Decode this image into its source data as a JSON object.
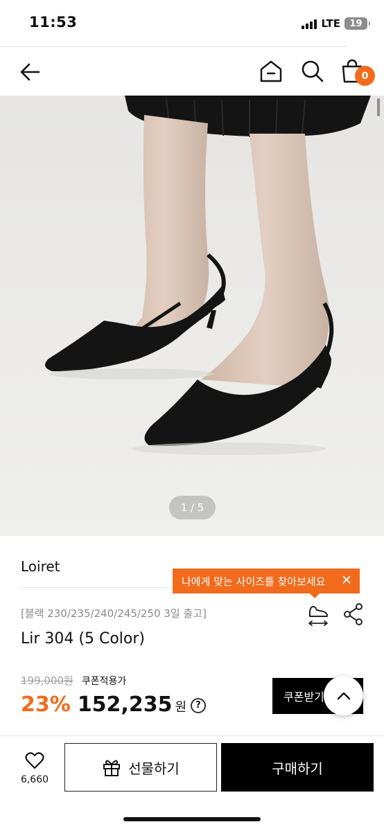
{
  "status_bar": {
    "time": "11:53",
    "network": "LTE",
    "battery": "19"
  },
  "nav": {
    "back_icon": "arrow-left-icon",
    "home_icon": "home-icon",
    "search_icon": "search-icon",
    "cart_icon": "shopping-bag-icon",
    "cart_count": "0"
  },
  "hero": {
    "pager": "1 / 5",
    "image_alt": "black pointed-toe slingback kitten heels"
  },
  "product": {
    "brand": "Loiret",
    "size_tooltip": "나에게 맞는 사이즈를 찾아보세요",
    "ship_note": "[블랙 230/235/240/245/250 3일 출고]",
    "name": "Lir 304 (5 Color)",
    "original_price": "199,000원",
    "coupon_label": "쿠폰적용가",
    "discount": "23%",
    "sale_price": "152,235",
    "currency": "원",
    "help": "?",
    "coupon_button": "쿠폰받기"
  },
  "bottom": {
    "like_count": "6,660",
    "gift_label": "선물하기",
    "buy_label": "구매하기"
  },
  "colors": {
    "accent": "#f26b1d",
    "black": "#000000"
  }
}
